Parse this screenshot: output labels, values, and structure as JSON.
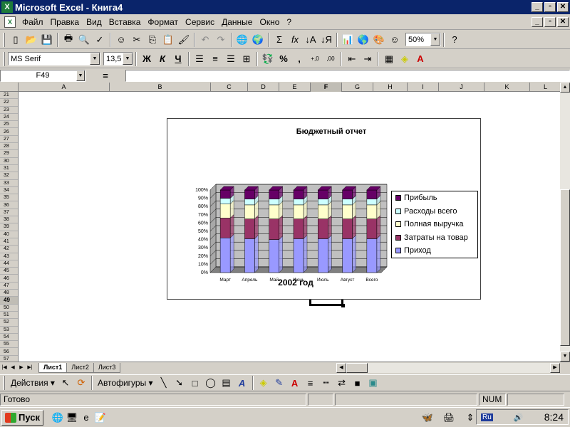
{
  "window": {
    "title": "Microsoft Excel - Книга4",
    "controls": [
      "_",
      "▫",
      "✕"
    ]
  },
  "menu": {
    "items": [
      "Файл",
      "Правка",
      "Вид",
      "Вставка",
      "Формат",
      "Сервис",
      "Данные",
      "Окно",
      "?"
    ]
  },
  "standard_toolbar": {
    "zoom": "50%",
    "icons": [
      "new-icon",
      "open-icon",
      "save-icon",
      "print-icon",
      "print-preview-icon",
      "spelling-icon",
      "smiley-icon",
      "cut-icon",
      "copy-icon",
      "paste-icon",
      "format-painter-icon",
      "undo-icon",
      "redo-icon",
      "web-icon",
      "globe-icon",
      "autosum-icon",
      "function-icon",
      "sort-asc-icon",
      "sort-desc-icon",
      "chart-wizard-icon",
      "map-icon",
      "drawing-icon",
      "smiley-icon",
      "help-icon"
    ]
  },
  "format_toolbar": {
    "font": "MS Serif",
    "size": "13,5",
    "bold": "Ж",
    "italic": "К",
    "underline": "Ч",
    "percent": "%",
    "comma": ",",
    "inc_decimal": "+,0",
    "dec_decimal": ",00"
  },
  "formula_bar": {
    "name_box": "F49",
    "equals": "=",
    "value": ""
  },
  "sheet": {
    "columns": [
      "A",
      "B",
      "C",
      "D",
      "E",
      "F",
      "G",
      "H",
      "I",
      "J",
      "K",
      "L"
    ],
    "active_column": "F",
    "rows": [
      "21",
      "22",
      "23",
      "24",
      "25",
      "26",
      "27",
      "28",
      "29",
      "30",
      "31",
      "32",
      "33",
      "34",
      "35",
      "36",
      "37",
      "38",
      "39",
      "40",
      "41",
      "42",
      "43",
      "44",
      "45",
      "46",
      "47",
      "48",
      "49",
      "50",
      "51",
      "52",
      "53",
      "54",
      "55",
      "56",
      "57"
    ],
    "active_row": "49",
    "tabs": [
      "Лист1",
      "Лист2",
      "Лист3"
    ],
    "active_tab": "Лист1"
  },
  "chart_data": {
    "type": "bar",
    "stacked": "100%",
    "three_d": true,
    "title": "Бюджетный отчет",
    "xlabel": "2002 год",
    "ylabel": "",
    "categories": [
      "Март",
      "Апрель",
      "Май",
      "Июнь",
      "Июль",
      "Август",
      "Всего"
    ],
    "yticks": [
      "0%",
      "10%",
      "20%",
      "30%",
      "40%",
      "50%",
      "60%",
      "70%",
      "80%",
      "90%",
      "100%"
    ],
    "ylim": [
      0,
      100
    ],
    "legend_position": "right",
    "series": [
      {
        "name": "Приход",
        "color": "#9999ff",
        "values": [
          42,
          41,
          40,
          41,
          41,
          41,
          41
        ]
      },
      {
        "name": "Затраты на товар",
        "color": "#993366",
        "values": [
          24,
          24,
          25,
          24,
          24,
          24,
          24
        ]
      },
      {
        "name": "Полная выручка",
        "color": "#ffffcc",
        "values": [
          17,
          17,
          17,
          17,
          17,
          17,
          17
        ]
      },
      {
        "name": "Расходы всего",
        "color": "#ccffff",
        "values": [
          7,
          7,
          7,
          7,
          7,
          7,
          7
        ]
      },
      {
        "name": "Прибыль",
        "color": "#660066",
        "values": [
          10,
          11,
          11,
          11,
          11,
          11,
          11
        ]
      }
    ]
  },
  "drawing_toolbar": {
    "actions": "Действия",
    "autoshapes": "Автофигуры"
  },
  "status": {
    "ready": "Готово",
    "num": "NUM"
  },
  "taskbar": {
    "start": "Пуск",
    "lang": "Ru",
    "clock": "8:24"
  }
}
